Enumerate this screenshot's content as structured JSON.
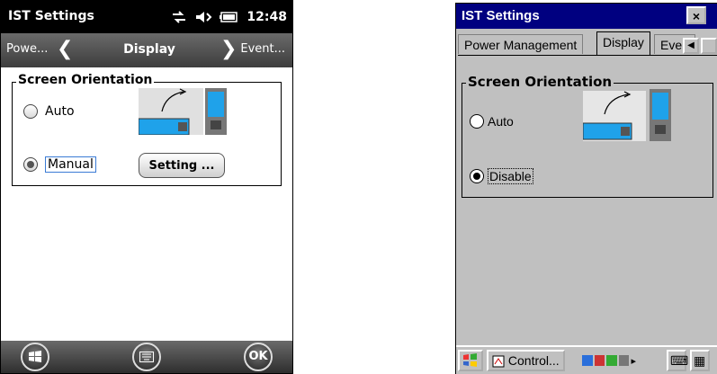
{
  "wm": {
    "title": "IST Settings",
    "status": {
      "time": "12:48",
      "icons": [
        "sync-icon",
        "speaker-icon",
        "battery-icon"
      ]
    },
    "nav": {
      "prev": "Powe...",
      "current": "Display",
      "next": "Event..."
    },
    "group": {
      "label": "Screen Orientation",
      "auto_label": "Auto",
      "manual_label": "Manual",
      "setting_button": "Setting ...",
      "selected": "Manual"
    },
    "softkeys": [
      "start-icon",
      "keyboard-icon",
      "OK"
    ]
  },
  "ce": {
    "title": "IST Settings",
    "close_label": "×",
    "tabs": [
      "Power Management",
      "Display",
      "Even"
    ],
    "active_tab": "Display",
    "scroll_left": "◀",
    "group": {
      "label": "Screen Orientation",
      "auto_label": "Auto",
      "disable_label": "Disable",
      "selected": "Disable"
    },
    "taskbar": {
      "control": "Control...",
      "tray_arrow": "▸"
    }
  },
  "colors": {
    "wm_title": "#000000",
    "ce_title": "#000080",
    "ce_face": "#c0c0c0",
    "screen_blue": "#1fa2ea"
  }
}
